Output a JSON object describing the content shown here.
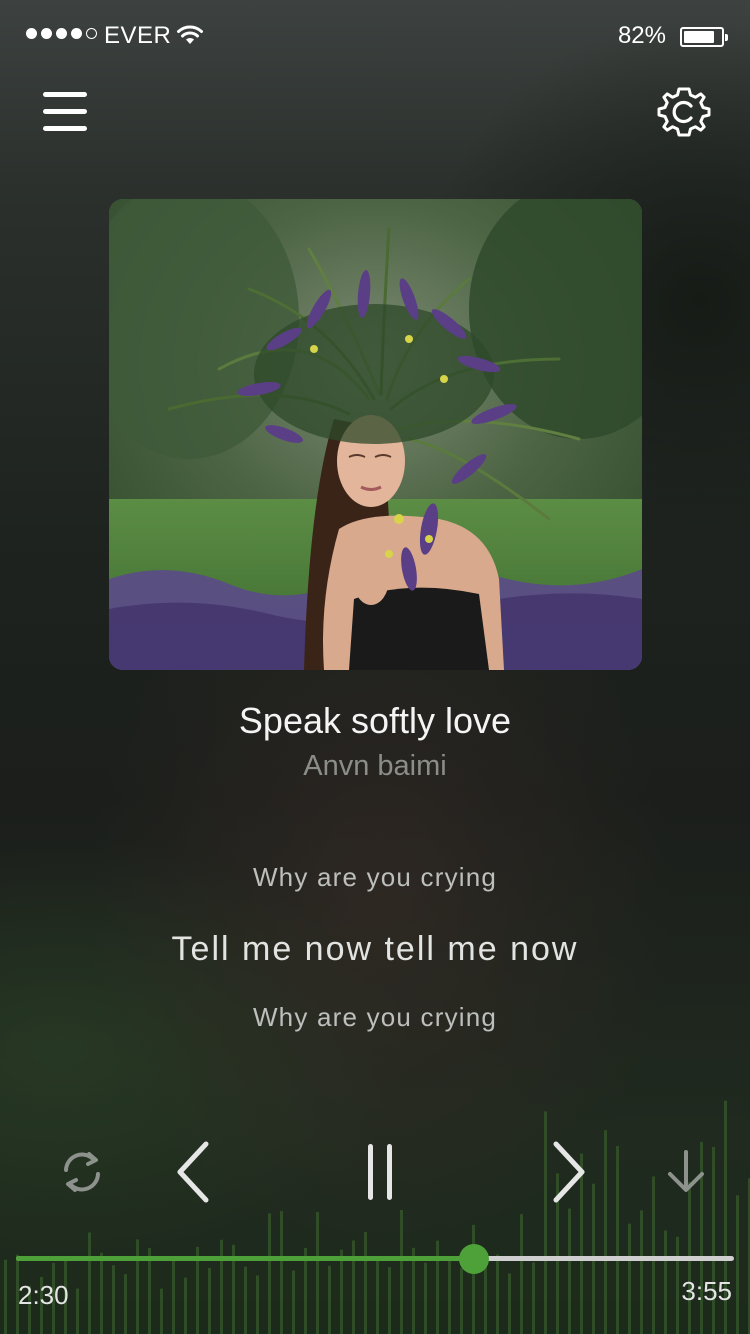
{
  "status_bar": {
    "signal_bars": 4,
    "signal_total": 5,
    "carrier": "EVER",
    "battery_percent": "82%",
    "battery_level": 0.82
  },
  "header": {
    "menu_icon": "hamburger-menu-icon",
    "settings_icon": "gear-icon"
  },
  "track": {
    "title": "Speak softly love",
    "artist": "Anvn baimi"
  },
  "lyrics": {
    "previous": "Why are you crying",
    "current": "Tell me now tell me now",
    "next": "Why are you crying"
  },
  "controls": {
    "repeat_icon": "repeat-icon",
    "previous_icon": "chevron-left-icon",
    "play_pause_icon": "pause-icon",
    "next_icon": "chevron-right-icon",
    "download_icon": "download-arrow-icon"
  },
  "progress": {
    "current_time": "2:30",
    "total_time": "3:55",
    "fraction": 0.6383
  },
  "colors": {
    "accent": "#4ea038",
    "track_inactive": "#cfcfcf"
  }
}
